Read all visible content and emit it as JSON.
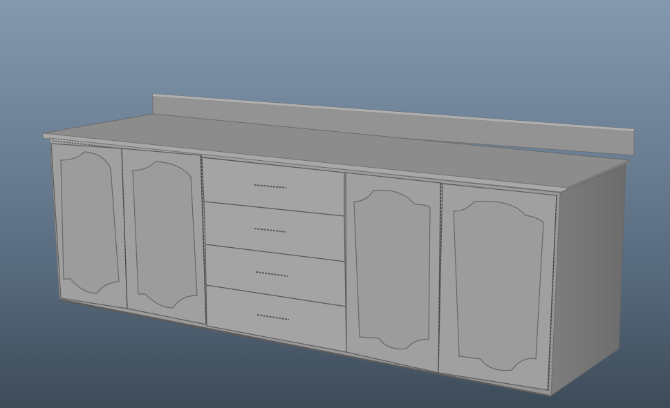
{
  "viewport": {
    "background_top": "#8499ad",
    "background_bottom": "#3d4b58"
  },
  "model": {
    "object": "cabinet",
    "door_count": 4,
    "drawer_count": 4,
    "material_color": "#9a9a9a",
    "countertop_color": "#8a8a8a"
  }
}
